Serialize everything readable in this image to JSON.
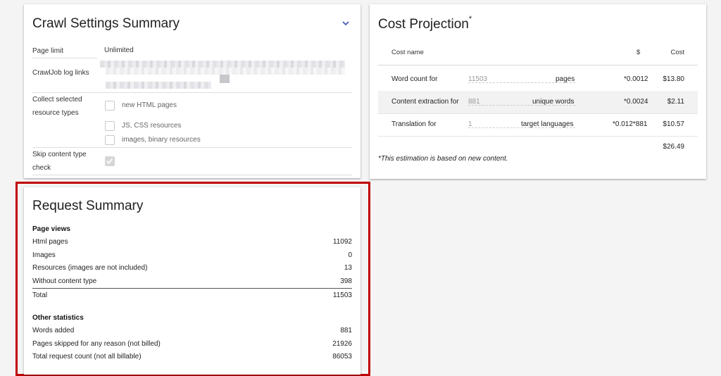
{
  "crawl_settings": {
    "title": "Crawl Settings Summary",
    "rows": {
      "page_limit_label": "Page limit",
      "page_limit_value": "Unlimited",
      "log_links_label": "CrawlJob log links",
      "collect_label": "Collect selected resource types",
      "collect_options": [
        "new HTML pages",
        "JS, CSS resources",
        "images, binary resources"
      ],
      "skip_label": "Skip content type check"
    }
  },
  "cost_projection": {
    "title": "Cost Projection",
    "title_mark": "*",
    "headers": {
      "name": "Cost name",
      "rate": "$",
      "cost": "Cost"
    },
    "rows": [
      {
        "label": "Word count for",
        "input": "11503",
        "unit": "pages",
        "rate": "*0.0012",
        "cost": "$13.80"
      },
      {
        "label": "Content extraction for",
        "input": "881",
        "unit": "unique words",
        "rate": "*0.0024",
        "cost": "$2.11"
      },
      {
        "label": "Translation for",
        "input": "1",
        "unit": "target languages",
        "rate": "*0.012*881",
        "cost": "$10.57"
      }
    ],
    "total": "$26.49",
    "note": "*This estimation is based on new content."
  },
  "request_summary": {
    "title": "Request Summary",
    "page_views": {
      "heading": "Page views",
      "rows": [
        {
          "label": "Html pages",
          "value": "11092"
        },
        {
          "label": "Images",
          "value": "0"
        },
        {
          "label": "Resources (images are not included)",
          "value": "13"
        },
        {
          "label": "Without content type",
          "value": "398"
        }
      ],
      "total_label": "Total",
      "total_value": "11503"
    },
    "other": {
      "heading": "Other statistics",
      "rows": [
        {
          "label": "Words added",
          "value": "881"
        },
        {
          "label": "Pages skipped for any reason (not billed)",
          "value": "21926"
        },
        {
          "label": "Total request count (not all billable)",
          "value": "86053"
        }
      ]
    }
  },
  "colors": {
    "highlight_border": "#c00000",
    "accent": "#3f51b5"
  }
}
